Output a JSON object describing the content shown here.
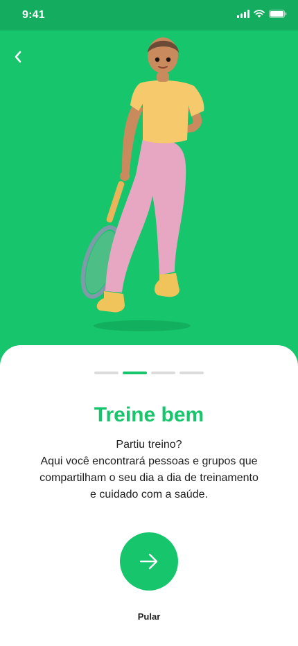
{
  "status_bar": {
    "time": "9:41"
  },
  "header": {
    "back_icon": "chevron-left-icon"
  },
  "pager": {
    "count": 4,
    "active_index": 1
  },
  "content": {
    "title": "Treine bem",
    "description_lines": [
      "Partiu treino?",
      "Aqui você encontrará pessoas e grupos que",
      "compartilham o seu dia a dia de treinamento",
      "e cuidado com a saúde."
    ]
  },
  "actions": {
    "next_icon": "arrow-right-icon",
    "skip_label": "Pular"
  },
  "colors": {
    "brand_green": "#17c56c",
    "status_green": "#14ad5f",
    "text_dark": "#1e1e1e",
    "pager_inactive": "#dcdcdc"
  }
}
